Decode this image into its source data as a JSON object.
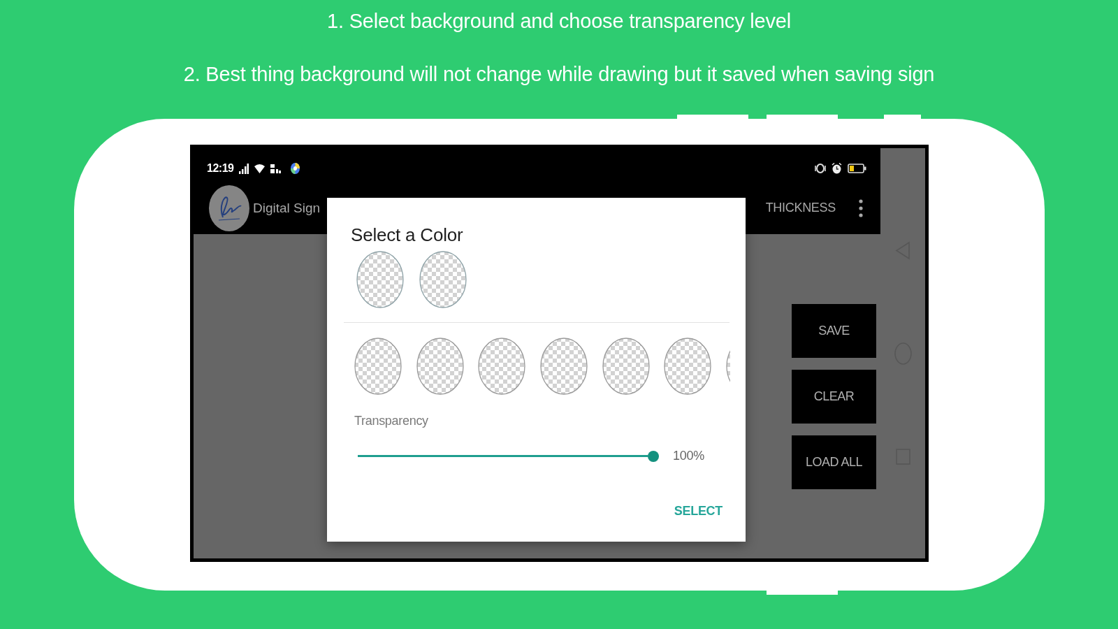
{
  "instructions": [
    "1. Select background and choose transparency level",
    "2. Best thing background will not change while drawing but it saved when saving sign"
  ],
  "phone": {
    "status_bar": {
      "time": "12:19"
    },
    "app_bar": {
      "title": "Digital Sign",
      "actions": [
        "THICKNESS"
      ]
    },
    "buttons": [
      "SAVE",
      "CLEAR",
      "LOAD ALL"
    ],
    "dialog": {
      "title": "Select a Color",
      "top_swatches": [
        {
          "kind": "transparent"
        },
        {
          "kind": "transparent"
        }
      ],
      "palette_swatches": [
        {
          "kind": "transparent"
        },
        {
          "kind": "transparent"
        },
        {
          "kind": "transparent"
        },
        {
          "kind": "transparent"
        },
        {
          "kind": "transparent"
        },
        {
          "kind": "transparent"
        },
        {
          "kind": "cut_off"
        }
      ],
      "transparency": {
        "label": "Transparency",
        "level": 1,
        "reading": "100%"
      },
      "buttons": [
        "SELECT"
      ]
    }
  }
}
